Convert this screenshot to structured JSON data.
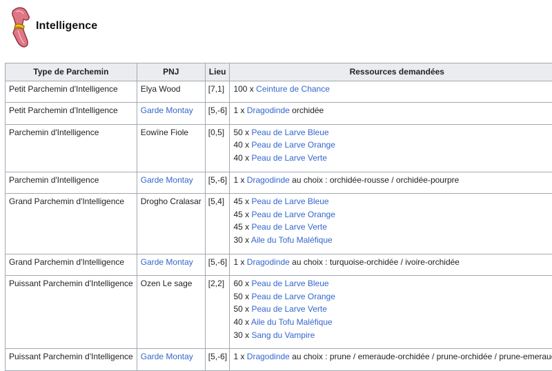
{
  "title": "Intelligence",
  "colors": {
    "link": "#3366cc",
    "header_bg": "#eaecf0",
    "border": "#a2a9b1",
    "icon": "#e07586"
  },
  "headers": [
    "Type de Parchemin",
    "PNJ",
    "Lieu",
    "Ressources demandées"
  ],
  "rows": [
    {
      "type": "Petit Parchemin d'Intelligence",
      "pnj": "Elya Wood",
      "pnj_link": false,
      "lieu": "[7,1]",
      "resources": [
        {
          "qty": "100 x ",
          "name": "Ceinture de Chance",
          "suffix": ""
        }
      ]
    },
    {
      "type": "Petit Parchemin d'Intelligence",
      "pnj": "Garde Montay",
      "pnj_link": true,
      "lieu": "[5,-6]",
      "resources": [
        {
          "qty": "1 x ",
          "name": "Dragodinde",
          "suffix": " orchidée"
        }
      ]
    },
    {
      "type": "Parchemin d'Intelligence",
      "pnj": "Eowïne Fiole",
      "pnj_link": false,
      "lieu": "[0,5]",
      "resources": [
        {
          "qty": "50 x ",
          "name": "Peau de Larve Bleue",
          "suffix": ""
        },
        {
          "qty": "40 x ",
          "name": "Peau de Larve Orange",
          "suffix": ""
        },
        {
          "qty": "40 x ",
          "name": "Peau de Larve Verte",
          "suffix": ""
        }
      ]
    },
    {
      "type": "Parchemin d'Intelligence",
      "pnj": "Garde Montay",
      "pnj_link": true,
      "lieu": "[5,-6]",
      "resources": [
        {
          "qty": "1 x ",
          "name": "Dragodinde",
          "suffix": " au choix : orchidée-rousse / orchidée-pourpre"
        }
      ]
    },
    {
      "type": "Grand Parchemin d'Intelligence",
      "pnj": "Drogho Cralasar",
      "pnj_link": false,
      "lieu": "[5,4]",
      "resources": [
        {
          "qty": "45 x ",
          "name": "Peau de Larve Bleue",
          "suffix": ""
        },
        {
          "qty": "45 x ",
          "name": "Peau de Larve Orange",
          "suffix": ""
        },
        {
          "qty": "45 x ",
          "name": "Peau de Larve Verte",
          "suffix": ""
        },
        {
          "qty": "30 x ",
          "name": "Aile du Tofu Maléfique",
          "suffix": ""
        }
      ]
    },
    {
      "type": "Grand Parchemin d'Intelligence",
      "pnj": "Garde Montay",
      "pnj_link": true,
      "lieu": "[5,-6]",
      "resources": [
        {
          "qty": "1 x ",
          "name": "Dragodinde",
          "suffix": " au choix : turquoise-orchidée / ivoire-orchidée"
        }
      ]
    },
    {
      "type": "Puissant Parchemin d'Intelligence",
      "pnj": "Ozen Le sage",
      "pnj_link": false,
      "lieu": "[2,2]",
      "resources": [
        {
          "qty": "60 x ",
          "name": "Peau de Larve Bleue",
          "suffix": ""
        },
        {
          "qty": "50 x ",
          "name": "Peau de Larve Orange",
          "suffix": ""
        },
        {
          "qty": "50 x ",
          "name": "Peau de Larve Verte",
          "suffix": ""
        },
        {
          "qty": "40 x ",
          "name": "Aile du Tofu Maléfique",
          "suffix": ""
        },
        {
          "qty": "30 x ",
          "name": "Sang du Vampire",
          "suffix": ""
        }
      ]
    },
    {
      "type": "Puissant Parchemin d'Intelligence",
      "pnj": "Garde Montay",
      "pnj_link": true,
      "lieu": "[5,-6]",
      "resources": [
        {
          "qty": "1 x ",
          "name": "Dragodinde",
          "suffix": " au choix : prune / emeraude-orchidée / prune-orchidée / prune-emeraude"
        }
      ]
    }
  ]
}
